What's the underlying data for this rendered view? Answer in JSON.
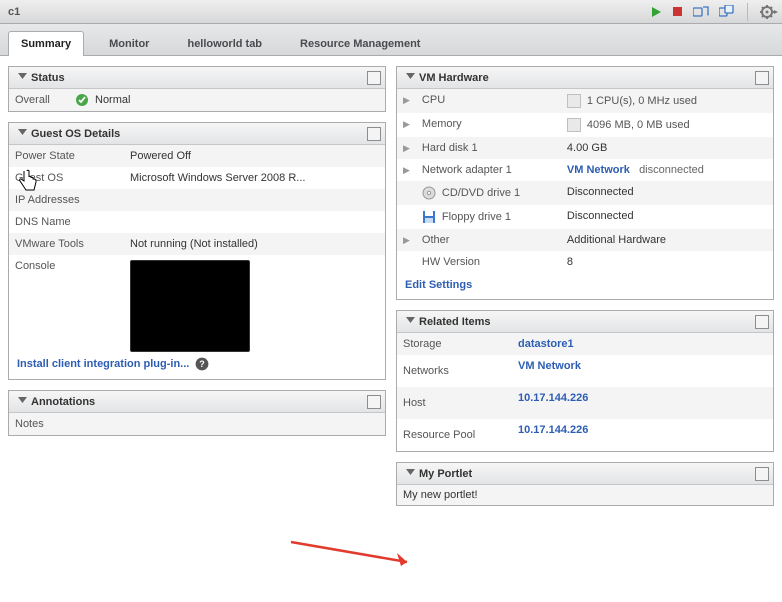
{
  "title": "c1",
  "tabs": {
    "summary": "Summary",
    "monitor": "Monitor",
    "custom": "helloworld tab",
    "resourcemgmt": "Resource Management"
  },
  "status": {
    "title": "Status",
    "overall_label": "Overall",
    "overall_value": "Normal"
  },
  "guest": {
    "title": "Guest OS Details",
    "labels": {
      "power": "Power State",
      "os": "Guest OS",
      "ip": "IP Addresses",
      "dns": "DNS Name",
      "tools": "VMware Tools",
      "console": "Console"
    },
    "values": {
      "power": "Powered Off",
      "os": "Microsoft Windows Server 2008 R...",
      "ip": "",
      "dns": "",
      "tools": "Not running   (Not installed)"
    },
    "install_link": "Install client integration plug-in..."
  },
  "annotations": {
    "title": "Annotations",
    "notes_label": "Notes",
    "notes_value": ""
  },
  "hw": {
    "title": "VM Hardware",
    "rows": {
      "cpu": {
        "label": "CPU",
        "value": "1 CPU(s), 0 MHz used"
      },
      "mem": {
        "label": "Memory",
        "value": "4096 MB, 0 MB used"
      },
      "disk": {
        "label": "Hard disk 1",
        "value": "4.00 GB"
      },
      "net": {
        "label": "Network adapter 1",
        "link": "VM Network",
        "extra": "disconnected"
      },
      "cd": {
        "label": "CD/DVD drive 1",
        "value": "Disconnected"
      },
      "fd": {
        "label": "Floppy drive 1",
        "value": "Disconnected"
      },
      "other": {
        "label": "Other",
        "value": "Additional Hardware"
      },
      "hwv": {
        "label": "HW Version",
        "value": "8"
      }
    },
    "edit_link": "Edit Settings"
  },
  "related": {
    "title": "Related Items",
    "rows": {
      "storage": {
        "label": "Storage",
        "link": "datastore1"
      },
      "networks": {
        "label": "Networks",
        "link": "VM Network"
      },
      "host": {
        "label": "Host",
        "link": "10.17.144.226"
      },
      "rp": {
        "label": "Resource Pool",
        "link": "10.17.144.226"
      }
    }
  },
  "myportlet": {
    "title": "My Portlet",
    "text": "My new portlet!"
  }
}
